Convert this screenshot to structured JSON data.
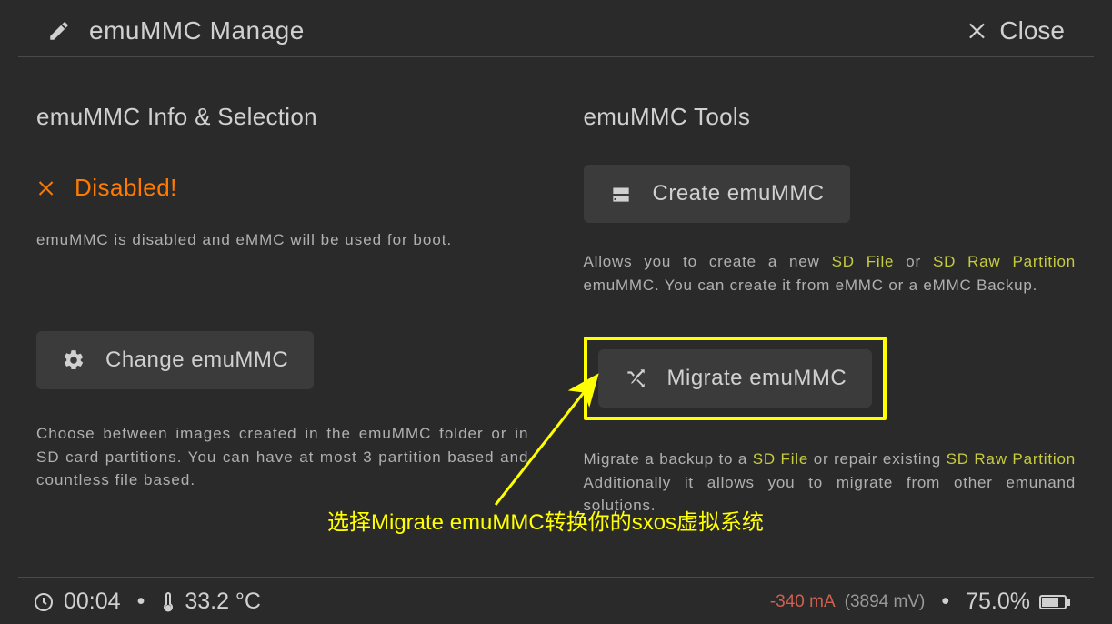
{
  "header": {
    "title": "emuMMC Manage",
    "close": "Close"
  },
  "left": {
    "title": "emuMMC Info & Selection",
    "status_label": "Disabled!",
    "status_desc": "emuMMC is disabled and eMMC will be used for boot.",
    "button": "Change emuMMC",
    "desc": "Choose between images created in the emuMMC folder or in SD card partitions. You can have at most 3 partition based and countless file based."
  },
  "right": {
    "title": "emuMMC Tools",
    "create_btn": "Create emuMMC",
    "create_desc_pre": "Allows you to create a new ",
    "create_desc_hl1": "SD File",
    "create_desc_mid": " or ",
    "create_desc_hl2": "SD Raw Partition",
    "create_desc_post": " emuMMC. You can create it from eMMC or a eMMC Backup.",
    "migrate_btn": "Migrate emuMMC",
    "migrate_desc_pre": "Migrate a backup to a ",
    "migrate_desc_hl1": "SD File",
    "migrate_desc_mid": " or repair existing ",
    "migrate_desc_hl2": "SD Raw Partition",
    "migrate_desc_post": " Additionally it allows you to migrate from other emunand solutions."
  },
  "annotation": "选择Migrate emuMMC转换你的sxos虚拟系统",
  "footer": {
    "time": "00:04",
    "temp": "33.2 °C",
    "current": "-340 mA",
    "voltage": "(3894 mV)",
    "battery": "75.0%"
  }
}
